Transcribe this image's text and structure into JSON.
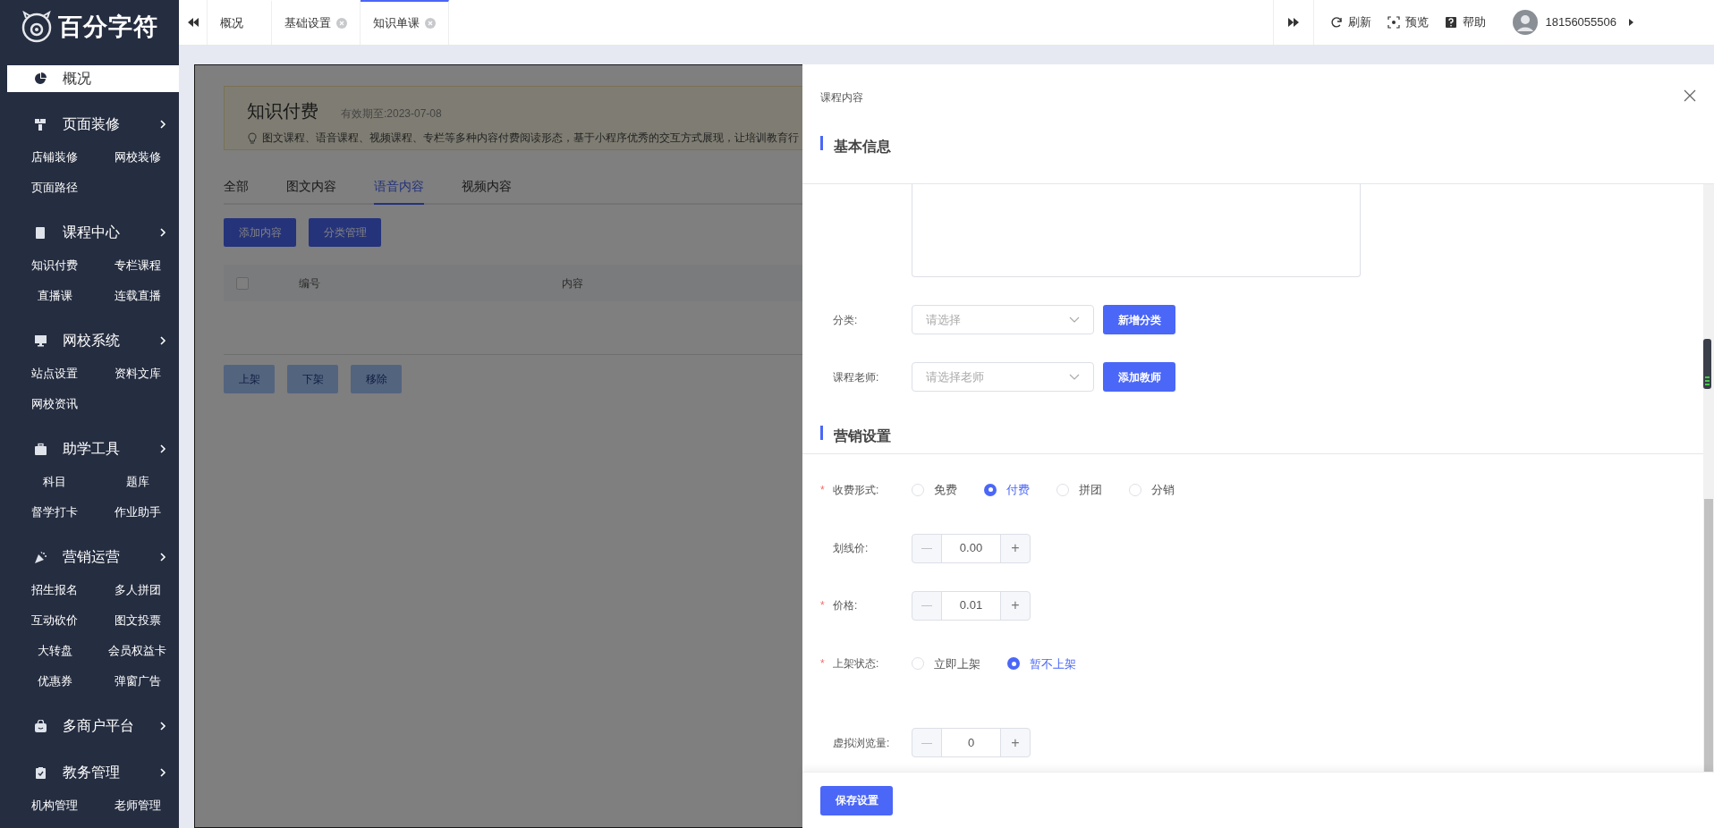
{
  "logo": {
    "text": "百分字符"
  },
  "sidebar": {
    "items": [
      {
        "label": "概况",
        "selected": true,
        "expandable": false
      },
      {
        "label": "页面装修",
        "selected": false,
        "expandable": true,
        "children": [
          "店铺装修",
          "网校装修",
          "页面路径"
        ]
      },
      {
        "label": "课程中心",
        "selected": false,
        "expandable": true,
        "children": [
          "知识付费",
          "专栏课程",
          "直播课",
          "连载直播"
        ]
      },
      {
        "label": "网校系统",
        "selected": false,
        "expandable": true,
        "children": [
          "站点设置",
          "资料文库",
          "网校资讯"
        ]
      },
      {
        "label": "助学工具",
        "selected": false,
        "expandable": true,
        "children": [
          "科目",
          "题库",
          "督学打卡",
          "作业助手"
        ]
      },
      {
        "label": "营销运营",
        "selected": false,
        "expandable": true,
        "children": [
          "招生报名",
          "多人拼团",
          "互动砍价",
          "图文投票",
          "大转盘",
          "会员权益卡",
          "优惠券",
          "弹窗广告"
        ]
      },
      {
        "label": "多商户平台",
        "selected": false,
        "expandable": true
      },
      {
        "label": "教务管理",
        "selected": false,
        "expandable": true,
        "children": [
          "机构管理",
          "老师管理"
        ]
      }
    ]
  },
  "topbar": {
    "tabs": [
      {
        "label": "概况",
        "selected": false,
        "closable": false
      },
      {
        "label": "基础设置",
        "selected": false,
        "closable": true
      },
      {
        "label": "知识单课",
        "selected": true,
        "closable": true
      }
    ],
    "actions": [
      "刷新",
      "预览",
      "帮助"
    ],
    "user": "18156055506"
  },
  "page": {
    "title": "知识付费",
    "expiry": "有效期至:2023-07-08",
    "description": "图文课程、语音课程、视频课程、专栏等多种内容付费阅读形态，基于小程序优秀的交互方式展现，让培训教育行",
    "tabs": [
      {
        "label": "全部",
        "selected": false
      },
      {
        "label": "图文内容",
        "selected": false
      },
      {
        "label": "语音内容",
        "selected": true
      },
      {
        "label": "视频内容",
        "selected": false
      }
    ],
    "buttons": [
      "添加内容",
      "分类管理"
    ],
    "table": {
      "checked": false,
      "columns": [
        "编号",
        "内容"
      ]
    },
    "bulk_buttons": [
      "上架",
      "下架",
      "移除"
    ]
  },
  "drawer": {
    "title": "课程内容",
    "sections": [
      {
        "title": "基本信息",
        "fields": [
          {
            "kind": "textarea"
          },
          {
            "kind": "select",
            "label": "分类:",
            "placeholder": "请选择",
            "button": "新增分类"
          },
          {
            "kind": "select",
            "label": "课程老师:",
            "placeholder": "请选择老师",
            "button": "添加教师"
          }
        ]
      },
      {
        "title": "营销设置",
        "fields": [
          {
            "kind": "radio",
            "label": "收费形式:",
            "required_mark": "*",
            "options": [
              {
                "label": "免费",
                "selected": false
              },
              {
                "label": "付费",
                "selected": true
              },
              {
                "label": "拼团",
                "selected": false
              },
              {
                "label": "分销",
                "selected": false
              }
            ]
          },
          {
            "kind": "number",
            "label": "划线价:",
            "value": "0.00",
            "minus": "—",
            "plus": "+"
          },
          {
            "kind": "number",
            "label": "价格:",
            "required_mark": "*",
            "value": "0.01",
            "minus": "—",
            "plus": "+"
          },
          {
            "kind": "radio",
            "label": "上架状态:",
            "required_mark": "*",
            "options": [
              {
                "label": "立即上架",
                "selected": false
              },
              {
                "label": "暂不上架",
                "selected": true
              }
            ]
          },
          {
            "kind": "number",
            "label": "虚拟浏览量:",
            "value": "0",
            "minus": "—",
            "plus": "+"
          }
        ]
      }
    ],
    "save": "保存设置"
  }
}
